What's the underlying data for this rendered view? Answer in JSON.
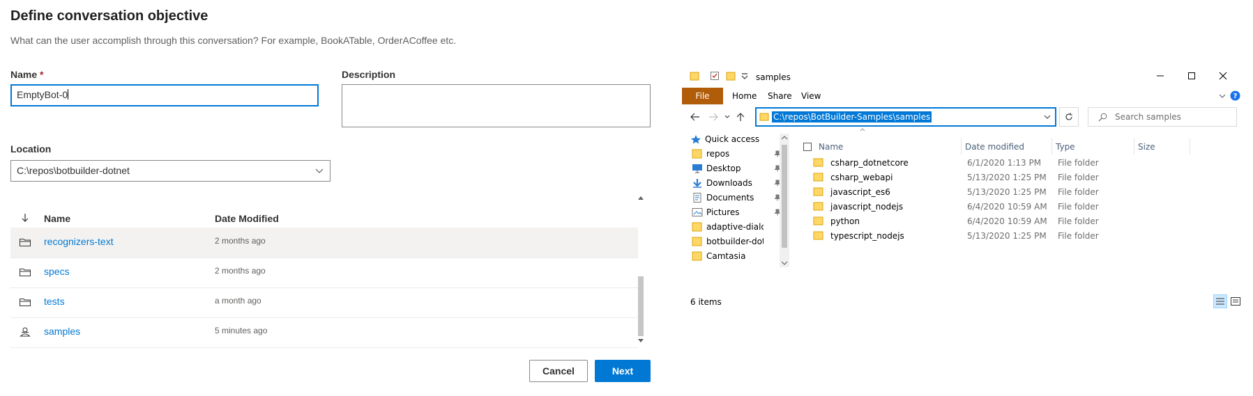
{
  "dialog": {
    "title": "Define conversation objective",
    "subtitle": "What can the user accomplish through this conversation? For example, BookATable, OrderACoffee etc.",
    "name_label": "Name",
    "required_mark": "*",
    "name_value": "EmptyBot-0",
    "description_label": "Description",
    "description_value": "",
    "location_label": "Location",
    "location_value": "C:\\repos\\botbuilder-dotnet",
    "list": {
      "sort_icon": "arrow-down-icon",
      "col_name": "Name",
      "col_date": "Date Modified",
      "rows": [
        {
          "name": "recognizers-text",
          "date": "2 months ago",
          "icon": "folder-icon"
        },
        {
          "name": "specs",
          "date": "2 months ago",
          "icon": "folder-icon"
        },
        {
          "name": "tests",
          "date": "a month ago",
          "icon": "folder-icon"
        },
        {
          "name": "samples",
          "date": "5 minutes ago",
          "icon": "bot-icon"
        }
      ]
    },
    "cancel_label": "Cancel",
    "next_label": "Next"
  },
  "explorer": {
    "title": "samples",
    "tabs": {
      "file": "File",
      "home": "Home",
      "share": "Share",
      "view": "View"
    },
    "address": "C:\\repos\\BotBuilder-Samples\\samples",
    "search_placeholder": "Search samples",
    "tree": [
      {
        "label": "Quick access",
        "icon": "star-icon",
        "pinned": false
      },
      {
        "label": "repos",
        "icon": "folder-icon",
        "pinned": true
      },
      {
        "label": "Desktop",
        "icon": "desktop-icon",
        "pinned": true
      },
      {
        "label": "Downloads",
        "icon": "download-icon",
        "pinned": true
      },
      {
        "label": "Documents",
        "icon": "documents-icon",
        "pinned": true
      },
      {
        "label": "Pictures",
        "icon": "pictures-icon",
        "pinned": true
      },
      {
        "label": "adaptive-dialog",
        "icon": "folder-icon",
        "pinned": false
      },
      {
        "label": "botbuilder-dotnet",
        "icon": "folder-icon",
        "pinned": false
      },
      {
        "label": "Camtasia",
        "icon": "folder-icon",
        "pinned": false
      }
    ],
    "columns": {
      "name": "Name",
      "date": "Date modified",
      "type": "Type",
      "size": "Size"
    },
    "files": [
      {
        "name": "csharp_dotnetcore",
        "date": "6/1/2020 1:13 PM",
        "type": "File folder"
      },
      {
        "name": "csharp_webapi",
        "date": "5/13/2020 1:25 PM",
        "type": "File folder"
      },
      {
        "name": "javascript_es6",
        "date": "5/13/2020 1:25 PM",
        "type": "File folder"
      },
      {
        "name": "javascript_nodejs",
        "date": "6/4/2020 10:59 AM",
        "type": "File folder"
      },
      {
        "name": "python",
        "date": "6/4/2020 10:59 AM",
        "type": "File folder"
      },
      {
        "name": "typescript_nodejs",
        "date": "5/13/2020 1:25 PM",
        "type": "File folder"
      }
    ],
    "status": "6 items"
  },
  "colors": {
    "accent": "#0078d4",
    "file_tab": "#b15c09",
    "folder": "#ffd766"
  }
}
